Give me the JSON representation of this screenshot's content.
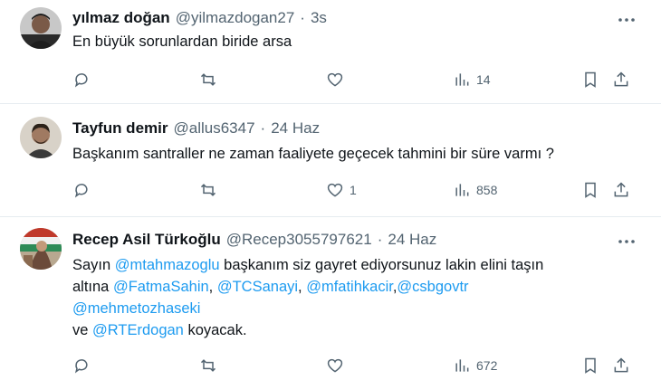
{
  "tweets": [
    {
      "name": "yılmaz doğan",
      "handle": "@yilmazdogan27",
      "sep": "·",
      "time": "3s",
      "text": "En büyük sorunlardan biride arsa",
      "likes": "",
      "views": "14"
    },
    {
      "name": "Tayfun demir",
      "handle": "@allus6347",
      "sep": "·",
      "time": "24 Haz",
      "text": "Başkanım santraller ne zaman faaliyete geçecek tahmini bir süre varmı ?",
      "likes": "1",
      "views": "858"
    },
    {
      "name": "Recep Asil Türkoğlu",
      "handle": "@Recep3055797621",
      "sep": "·",
      "time": "24 Haz",
      "text_parts": {
        "p1": "Sayın ",
        "m1": "@mtahmazoglu",
        "p2": " başkanım siz gayret ediyorsunuz lakin elini taşın",
        "p3": "altına ",
        "m2": "@FatmaSahin",
        "c1": ", ",
        "m3": "@TCSanayi",
        "c2": ", ",
        "m4": "@mfatihkacir",
        "c3": ",",
        "m5": "@csbgovtr",
        "m6": "@mehmetozhaseki",
        "p4": "ve ",
        "m7": "@RTErdogan",
        "p5": " koyacak."
      },
      "likes": "",
      "views": "672"
    }
  ],
  "icons": {
    "more": "more-horizontal-icon",
    "reply": "reply-icon",
    "retweet": "retweet-icon",
    "like": "heart-icon",
    "views": "views-chart-icon",
    "bookmark": "bookmark-icon",
    "share": "share-icon"
  },
  "colors": {
    "mention": "#1d9bf0",
    "secondary": "#536471",
    "divider": "#e6ecf0"
  }
}
